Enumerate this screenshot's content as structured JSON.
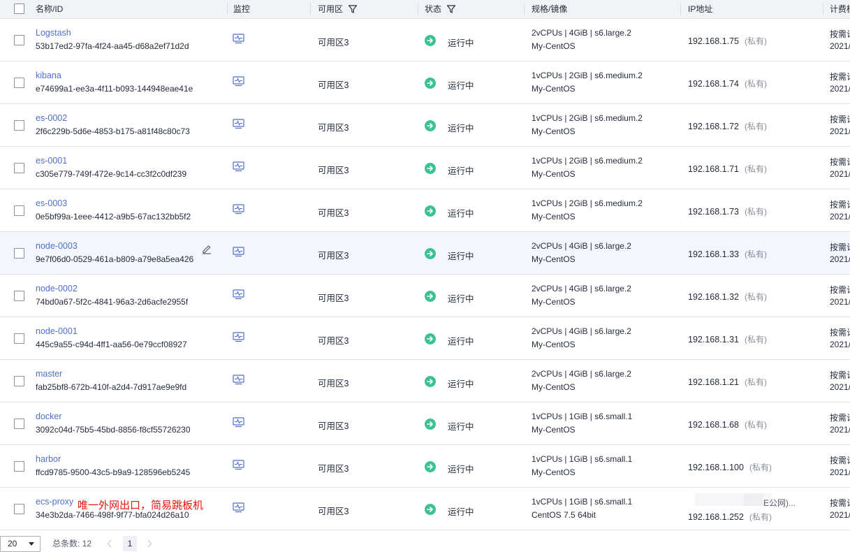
{
  "header": {
    "name_id": "名称/ID",
    "monitor": "监控",
    "zone": "可用区",
    "status": "状态",
    "spec": "规格/镜像",
    "ip": "IP地址",
    "billing": "计费模"
  },
  "instances": [
    {
      "name": "Logstash",
      "id": "53b17ed2-97fa-4f24-aa45-d68a2ef71d2d",
      "zone": "可用区3",
      "status": "运行中",
      "spec": "2vCPUs | 4GiB | s6.large.2",
      "image": "My-CentOS",
      "ip": "192.168.1.75",
      "ip_type": "(私有)",
      "billing": "按需计",
      "date": "2021/"
    },
    {
      "name": "kibana",
      "id": "e74699a1-ee3a-4f11-b093-144948eae41e",
      "zone": "可用区3",
      "status": "运行中",
      "spec": "1vCPUs | 2GiB | s6.medium.2",
      "image": "My-CentOS",
      "ip": "192.168.1.74",
      "ip_type": "(私有)",
      "billing": "按需计",
      "date": "2021/"
    },
    {
      "name": "es-0002",
      "id": "2f6c229b-5d6e-4853-b175-a81f48c80c73",
      "zone": "可用区3",
      "status": "运行中",
      "spec": "1vCPUs | 2GiB | s6.medium.2",
      "image": "My-CentOS",
      "ip": "192.168.1.72",
      "ip_type": "(私有)",
      "billing": "按需计",
      "date": "2021/"
    },
    {
      "name": "es-0001",
      "id": "c305e779-749f-472e-9c14-cc3f2c0df239",
      "zone": "可用区3",
      "status": "运行中",
      "spec": "1vCPUs | 2GiB | s6.medium.2",
      "image": "My-CentOS",
      "ip": "192.168.1.71",
      "ip_type": "(私有)",
      "billing": "按需计",
      "date": "2021/"
    },
    {
      "name": "es-0003",
      "id": "0e5bf99a-1eee-4412-a9b5-67ac132bb5f2",
      "zone": "可用区3",
      "status": "运行中",
      "spec": "1vCPUs | 2GiB | s6.medium.2",
      "image": "My-CentOS",
      "ip": "192.168.1.73",
      "ip_type": "(私有)",
      "billing": "按需计",
      "date": "2021/"
    },
    {
      "name": "node-0003",
      "id": "9e7f06d0-0529-461a-b809-a79e8a5ea426",
      "zone": "可用区3",
      "status": "运行中",
      "spec": "2vCPUs | 4GiB | s6.large.2",
      "image": "My-CentOS",
      "ip": "192.168.1.33",
      "ip_type": "(私有)",
      "billing": "按需计",
      "date": "2021/"
    },
    {
      "name": "node-0002",
      "id": "74bd0a67-5f2c-4841-96a3-2d6acfe2955f",
      "zone": "可用区3",
      "status": "运行中",
      "spec": "2vCPUs | 4GiB | s6.large.2",
      "image": "My-CentOS",
      "ip": "192.168.1.32",
      "ip_type": "(私有)",
      "billing": "按需计",
      "date": "2021/"
    },
    {
      "name": "node-0001",
      "id": "445c9a55-c94d-4ff1-aa56-0e79ccf08927",
      "zone": "可用区3",
      "status": "运行中",
      "spec": "2vCPUs | 4GiB | s6.large.2",
      "image": "My-CentOS",
      "ip": "192.168.1.31",
      "ip_type": "(私有)",
      "billing": "按需计",
      "date": "2021/"
    },
    {
      "name": "master",
      "id": "fab25bf8-672b-410f-a2d4-7d917ae9e9fd",
      "zone": "可用区3",
      "status": "运行中",
      "spec": "2vCPUs | 4GiB | s6.large.2",
      "image": "My-CentOS",
      "ip": "192.168.1.21",
      "ip_type": "(私有)",
      "billing": "按需计",
      "date": "2021/"
    },
    {
      "name": "docker",
      "id": "3092c04d-75b5-45bd-8856-f8cf55726230",
      "zone": "可用区3",
      "status": "运行中",
      "spec": "1vCPUs | 1GiB | s6.small.1",
      "image": "My-CentOS",
      "ip": "192.168.1.68",
      "ip_type": "(私有)",
      "billing": "按需计",
      "date": "2021/"
    },
    {
      "name": "harbor",
      "id": "ffcd9785-9500-43c5-b9a9-128596eb5245",
      "zone": "可用区3",
      "status": "运行中",
      "spec": "1vCPUs | 1GiB | s6.small.1",
      "image": "My-CentOS",
      "ip": "192.168.1.100",
      "ip_type": "(私有)",
      "billing": "按需计",
      "date": "2021/"
    },
    {
      "name": "ecs-proxy",
      "id": "34e3b2da-7466-498f-9f77-bfa024d26a10",
      "zone": "可用区3",
      "status": "运行中",
      "spec": "1vCPUs | 1GiB | s6.small.1",
      "image": "CentOS 7.5 64bit",
      "ip": "192.168.1.252",
      "ip_type": "(私有)",
      "public_ip_fragment": "E公网)...",
      "billing": "按需计",
      "date": "2021/",
      "annotation": "唯一外网出口，简易跳板机"
    }
  ],
  "footer": {
    "page_size": "20",
    "total": "总条数: 12",
    "current_page": "1"
  },
  "colors": {
    "link": "#526ecc",
    "status_running": "#3ac295",
    "annotation": "#e8120c",
    "header_bg": "#f2f3f5"
  }
}
